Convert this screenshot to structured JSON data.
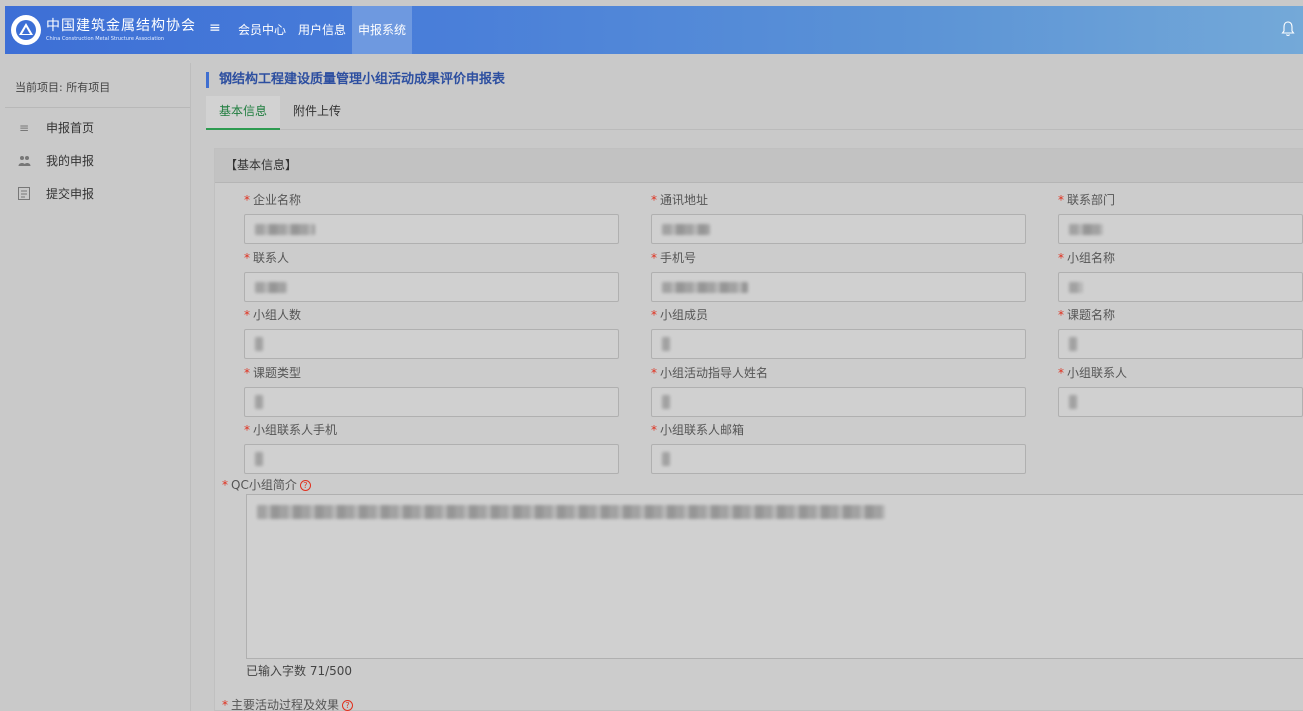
{
  "header": {
    "logo_cn": "中国建筑金属结构协会",
    "logo_en": "China Construction Metal Structure Association",
    "nav": [
      "会员中心",
      "用户信息",
      "申报系统"
    ],
    "active_nav": "申报系统"
  },
  "sidebar": {
    "crumb": "当前项目: 所有项目",
    "items": [
      {
        "label": "申报首页",
        "icon": "menu-icon"
      },
      {
        "label": "我的申报",
        "icon": "users-icon"
      },
      {
        "label": "提交申报",
        "icon": "document-icon"
      }
    ]
  },
  "main": {
    "title": "钢结构工程建设质量管理小组活动成果评价申报表",
    "tabs": [
      "基本信息",
      "附件上传"
    ],
    "section_title": "【基本信息】",
    "fields": [
      {
        "label": "企业名称"
      },
      {
        "label": "通讯地址"
      },
      {
        "label": "联系部门"
      },
      {
        "label": "联系人"
      },
      {
        "label": "手机号"
      },
      {
        "label": "小组名称"
      },
      {
        "label": "小组人数"
      },
      {
        "label": "小组成员"
      },
      {
        "label": "课题名称"
      },
      {
        "label": "课题类型"
      },
      {
        "label": "小组活动指导人姓名"
      },
      {
        "label": "小组联系人"
      },
      {
        "label": "小组联系人手机"
      },
      {
        "label": "小组联系人邮箱"
      }
    ],
    "intro_label": "QC小组简介",
    "char_count": "已输入字数 71/500",
    "next_label": "主要活动过程及效果"
  },
  "colors": {
    "topbar_start": "#3d6fd6",
    "topbar_end": "#74a9d8",
    "required": "#e0301e",
    "active_tab": "#1f7d3e",
    "title": "#2d4fa0"
  }
}
